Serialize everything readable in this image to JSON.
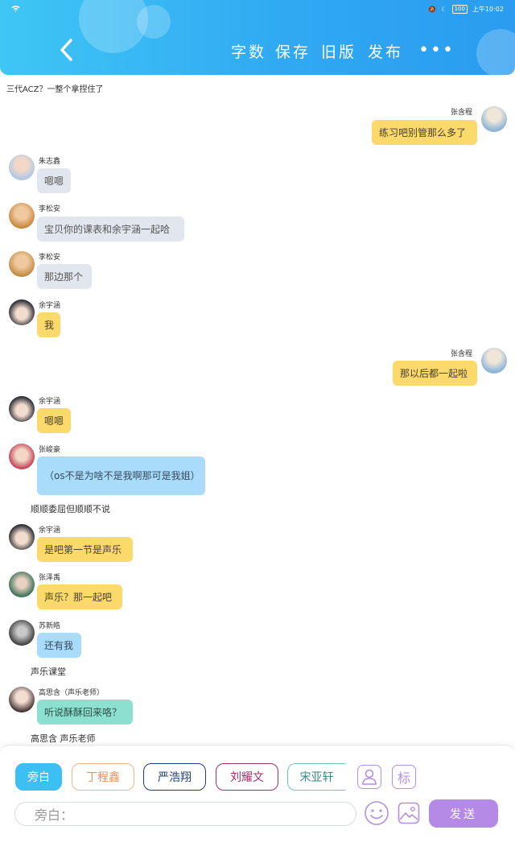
{
  "status": {
    "wifi": "wifi",
    "battery": "100",
    "time": "上午10:02"
  },
  "header": {
    "nav": [
      "字数",
      "保存",
      "旧版",
      "发布"
    ],
    "more": "•••"
  },
  "chat": {
    "top_text": "三代ACZ？一整个拿捏住了",
    "messages": [
      {
        "name": "张含程",
        "text": "练习吧别管那么多了"
      },
      {
        "name": "朱志鑫",
        "text": "嗯嗯"
      },
      {
        "name": "李松安",
        "text": "宝贝你的课表和余宇涵一起哈"
      },
      {
        "name": "李松安",
        "text": "那边那个"
      },
      {
        "name": "余宇涵",
        "text": "我"
      },
      {
        "name": "张含程",
        "text": "那以后都一起啦"
      },
      {
        "name": "余宇涵",
        "text": "嗯嗯"
      },
      {
        "name": "张峻豪",
        "text": "（os不是为啥不是我啊那可是我姐）"
      },
      {
        "name": "余宇涵",
        "text": "是吧第一节是声乐"
      },
      {
        "name": "张泽禹",
        "text": "声乐？那一起吧"
      },
      {
        "name": "苏新皓",
        "text": "还有我"
      },
      {
        "name": "高思含（声乐老师）",
        "text": "听说酥酥回来咯？"
      }
    ],
    "narrations": [
      "顺顺委屈但顺顺不说",
      "声乐课堂",
      "高思含 声乐老师"
    ]
  },
  "composer": {
    "chips": [
      "旁白",
      "丁程鑫",
      "严浩翔",
      "刘耀文",
      "宋亚轩"
    ],
    "avatar_tool": "头像",
    "mark_tool": "标",
    "input_placeholder": "旁白：",
    "send_label": "发送"
  },
  "colors": {
    "header": "#30a9f2",
    "accent_purple": "#b58ae6",
    "bubble_yellow": "#fbd96b",
    "bubble_blue": "#a9dcfa",
    "bubble_gray": "#e2e6ee",
    "bubble_teal": "#8be0d0"
  }
}
